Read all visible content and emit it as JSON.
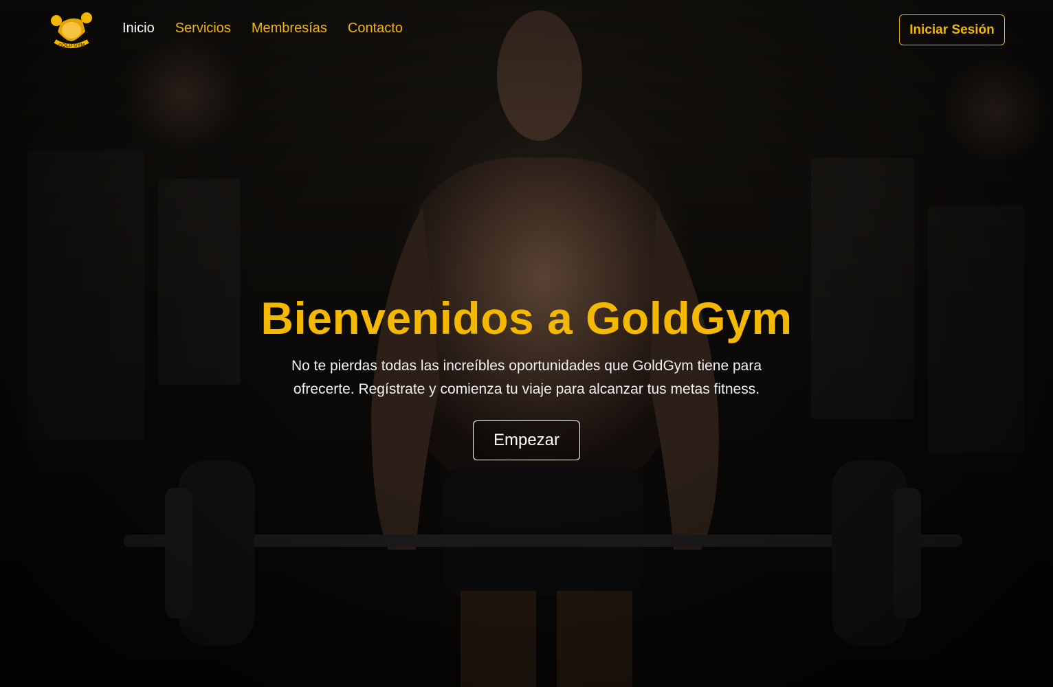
{
  "brand": {
    "logo_text": "GOLD GYM",
    "icon": "bodybuilder-logo-icon",
    "accent_color": "#f5b800"
  },
  "nav": {
    "items": [
      {
        "label": "Inicio",
        "active": true
      },
      {
        "label": "Servicios",
        "active": false
      },
      {
        "label": "Membresías",
        "active": false
      },
      {
        "label": "Contacto",
        "active": false
      }
    ],
    "login_label": "Iniciar Sesión"
  },
  "hero": {
    "title": "Bienvenidos a GoldGym",
    "subtitle": "No te pierdas todas las increíbles oportunidades que GoldGym tiene para ofrecerte. Regístrate y comienza tu viaje para alcanzar tus metas fitness.",
    "cta_label": "Empezar",
    "background_image": "bodybuilder-with-barbell-photo"
  }
}
